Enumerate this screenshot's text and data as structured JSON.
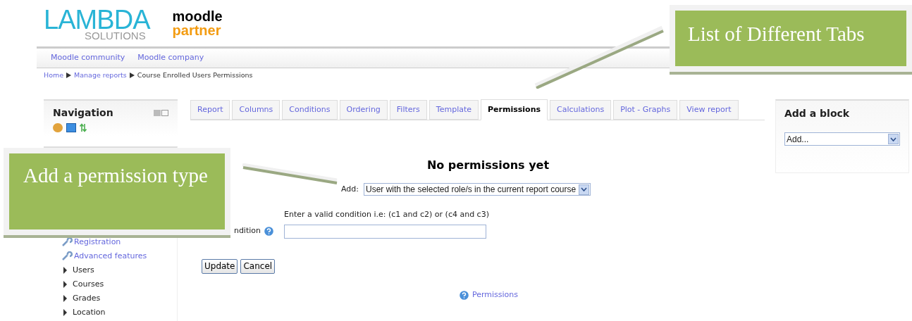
{
  "header": {
    "logo_main": "LAMBDA",
    "logo_sub": "SOLUTIONS",
    "partner_top": "moodle",
    "partner_bottom": "partner"
  },
  "custom_menu": [
    "Moodle community",
    "Moodle company"
  ],
  "breadcrumb": [
    {
      "label": "Home",
      "link": true
    },
    {
      "label": "Manage reports",
      "link": true
    },
    {
      "label": "Course Enrolled Users Permissions",
      "link": false
    }
  ],
  "navigation_block": {
    "title": "Navigation"
  },
  "admin_block": {
    "items": [
      {
        "label": "Registration",
        "kind": "link"
      },
      {
        "label": "Advanced features",
        "kind": "link"
      },
      {
        "label": "Users",
        "kind": "folder"
      },
      {
        "label": "Courses",
        "kind": "folder"
      },
      {
        "label": "Grades",
        "kind": "folder"
      },
      {
        "label": "Location",
        "kind": "folder"
      }
    ]
  },
  "tabs": [
    {
      "label": "Report",
      "selected": false
    },
    {
      "label": "Columns",
      "selected": false
    },
    {
      "label": "Conditions",
      "selected": false
    },
    {
      "label": "Ordering",
      "selected": false
    },
    {
      "label": "Filters",
      "selected": false
    },
    {
      "label": "Template",
      "selected": false
    },
    {
      "label": "Permissions",
      "selected": true
    },
    {
      "label": "Calculations",
      "selected": false
    },
    {
      "label": "Plot - Graphs",
      "selected": false
    },
    {
      "label": "View report",
      "selected": false
    }
  ],
  "heading": "No permissions yet",
  "add_field": {
    "label": "Add:",
    "value": "User with the selected role/s in the current report course"
  },
  "condition": {
    "hint": "Enter a valid condition i.e: (c1 and c2) or (c4 and c3)",
    "label": "ndition"
  },
  "buttons": [
    "Update",
    "Cancel"
  ],
  "help_link": "Permissions",
  "add_block": {
    "title": "Add a block",
    "value": "Add..."
  },
  "callouts": [
    {
      "text": "List of Different Tabs"
    },
    {
      "text": "Add a permission type"
    }
  ]
}
